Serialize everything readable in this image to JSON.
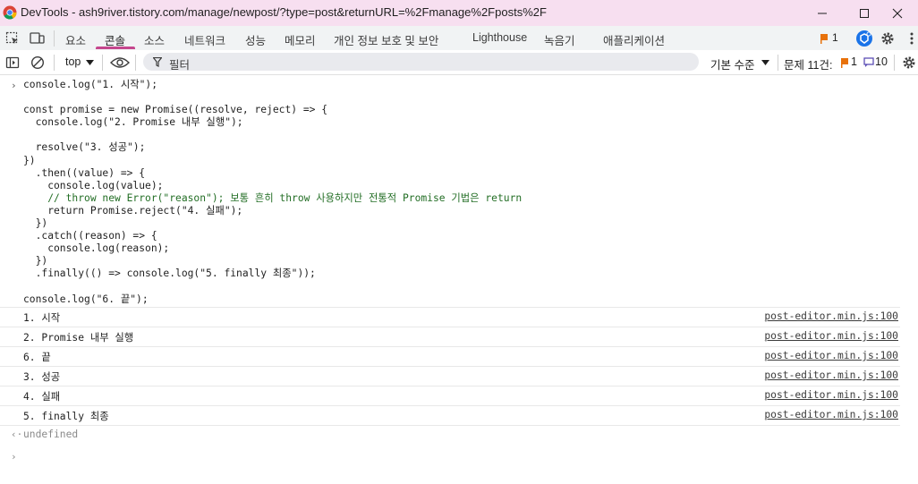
{
  "window": {
    "title": "DevTools - ash9river.tistory.com/manage/newpost/?type=post&returnURL=%2Fmanage%2Fposts%2F"
  },
  "tabs": {
    "items": [
      "요소",
      "콘솔",
      "소스",
      "네트워크",
      "성능",
      "메모리",
      "개인 정보 보호 및 보안",
      "Lighthouse",
      "녹음기",
      "애플리케이션"
    ],
    "active": "콘솔",
    "issues_badge": "1"
  },
  "toolbar": {
    "context": "top",
    "filter_placeholder": "필터",
    "levels": "기본 수준",
    "issues_label": "문제 11건:",
    "issues_warnings": "1",
    "issues_info": "10"
  },
  "console": {
    "input_lines": [
      "console.log(\"1. 시작\");",
      "",
      "const promise = new Promise((resolve, reject) => {",
      "  console.log(\"2. Promise 내부 실행\");",
      "",
      "  resolve(\"3. 성공\");",
      "})",
      "  .then((value) => {",
      "    console.log(value);",
      "    // throw new Error(\"reason\"); 보통 흔히 throw 사용하지만 전통적 Promise 기법은 return",
      "    return Promise.reject(\"4. 실패\");",
      "  })",
      "  .catch((reason) => {",
      "    console.log(reason);",
      "  })",
      "  .finally(() => console.log(\"5. finally 최종\"));",
      "",
      "console.log(\"6. 끝\");"
    ],
    "logs": [
      {
        "text": "1. 시작",
        "source": "post-editor.min.js:100"
      },
      {
        "text": "2. Promise 내부 실행",
        "source": "post-editor.min.js:100"
      },
      {
        "text": "6. 끝",
        "source": "post-editor.min.js:100"
      },
      {
        "text": "3. 성공",
        "source": "post-editor.min.js:100"
      },
      {
        "text": "4. 실패",
        "source": "post-editor.min.js:100"
      },
      {
        "text": "5. finally 최종",
        "source": "post-editor.min.js:100"
      }
    ],
    "result": "undefined"
  },
  "colors": {
    "titlebar": "#f7dff0",
    "accent": "#c5468d",
    "keyword": "#c80000",
    "string": "#c41a16",
    "comment": "#236e25"
  }
}
